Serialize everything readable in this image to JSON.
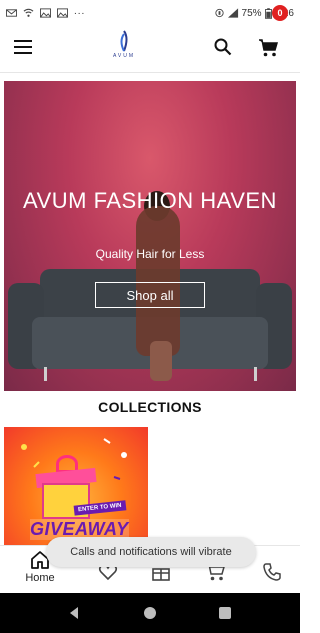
{
  "status_bar": {
    "battery": "75%",
    "time": "7:26",
    "overflow": "..."
  },
  "header": {
    "logo_text": "AVUM",
    "cart_count": "0"
  },
  "hero": {
    "title": "AVUM FASHION HAVEN",
    "subtitle": "Quality Hair for Less",
    "button_label": "Shop all"
  },
  "collections": {
    "title": "COLLECTIONS",
    "card": {
      "tag": "ENTER TO WIN",
      "headline": "GIVEAWAY"
    }
  },
  "bottom_nav": {
    "items": [
      {
        "label": "Home",
        "icon": "home-icon",
        "active": true
      },
      {
        "label": "",
        "icon": "heart-icon"
      },
      {
        "label": "",
        "icon": "gift-icon"
      },
      {
        "label": "",
        "icon": "cart-icon"
      },
      {
        "label": "",
        "icon": "phone-icon"
      }
    ]
  },
  "toast": {
    "message": "Calls and notifications will vibrate"
  },
  "colors": {
    "accent": "#e02020",
    "hero_bg": "#b83a5a"
  }
}
